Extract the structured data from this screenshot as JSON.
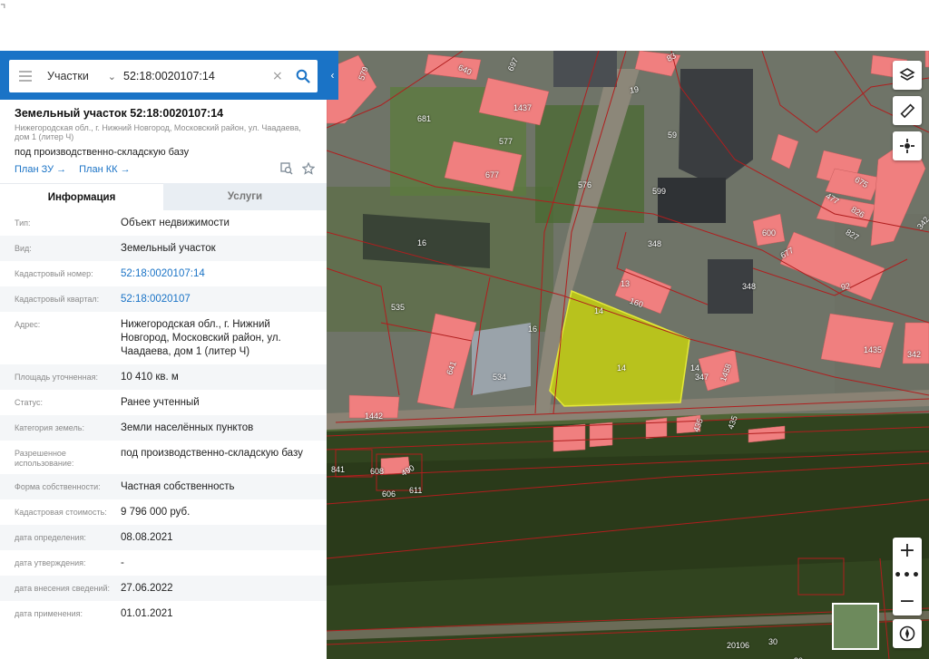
{
  "top_glyph": "⌝",
  "search": {
    "type_label": "Участки",
    "query": "52:18:0020107:14",
    "clear_symbol": "×"
  },
  "panel": {
    "title": "Земельный участок 52:18:0020107:14",
    "address_short": "Нижегородская обл., г. Нижний Новгород, Московский район, ул. Чаадаева, дом 1 (литер Ч)",
    "purpose": "под производственно-складскую базу",
    "link_plan_zu": "План ЗУ →",
    "link_plan_kk": "План КК →"
  },
  "tabs": {
    "info": "Информация",
    "services": "Услуги"
  },
  "rows": [
    {
      "label": "Тип:",
      "value": "Объект недвижимости",
      "h": 28
    },
    {
      "label": "Вид:",
      "value": "Земельный участок",
      "h": 28
    },
    {
      "label": "Кадастровый номер:",
      "value": "52:18:0020107:14",
      "link": true,
      "h": 28
    },
    {
      "label": "Кадастровый квартал:",
      "value": "52:18:0020107",
      "link": true,
      "h": 28
    },
    {
      "label": "Адрес:",
      "value": "Нижегородская обл., г. Нижний Новгород, Московский район, ул. Чаадаева, дом 1 (литер Ч)",
      "h": 58
    },
    {
      "label": "Площадь уточненная:",
      "value": "10 410 кв. м",
      "h": 28
    },
    {
      "label": "Статус:",
      "value": "Ранее учтенный",
      "h": 28
    },
    {
      "label": "Категория земель:",
      "value": "Земли населённых пунктов",
      "h": 28
    },
    {
      "label": "Разрешенное использование:",
      "value": "под производственно-складскую базу",
      "h": 37
    },
    {
      "label": "Форма собственности:",
      "value": "Частная собственность",
      "h": 28
    },
    {
      "label": "Кадастровая стоимость:",
      "value": "9 796 000 руб.",
      "h": 28
    },
    {
      "label": "дата определения:",
      "value": "08.08.2021",
      "h": 28
    },
    {
      "label": "дата утверждения:",
      "value": "-",
      "h": 28
    },
    {
      "label": "дата внесения сведений:",
      "value": "27.06.2022",
      "h": 28
    },
    {
      "label": "дата применения:",
      "value": "01.01.2021",
      "h": 28
    }
  ],
  "map": {
    "parcel_numbers": [
      "579",
      "640",
      "697",
      "83",
      "681",
      "1437",
      "577",
      "19",
      "59",
      "677",
      "576",
      "16",
      "599",
      "13",
      "160",
      "348",
      "600",
      "92",
      "477",
      "675",
      "826",
      "827",
      "677",
      "342",
      "348",
      "535",
      "16",
      "14",
      "14",
      "347",
      "1458",
      "1435",
      "342",
      "534",
      "1442",
      "641",
      "435",
      "435",
      "490",
      "606",
      "608",
      "611",
      "841",
      "20106",
      "30",
      "20106",
      "30",
      "14"
    ],
    "selected_parcel_number": "14",
    "zoom_in": "+",
    "zoom_dots": "•••",
    "zoom_out": "−"
  },
  "colors": {
    "brand": "#1a73c6",
    "building_fill": "#f07f7f",
    "selected_parcel": "#d4e000",
    "boundary": "#b01e1e"
  }
}
